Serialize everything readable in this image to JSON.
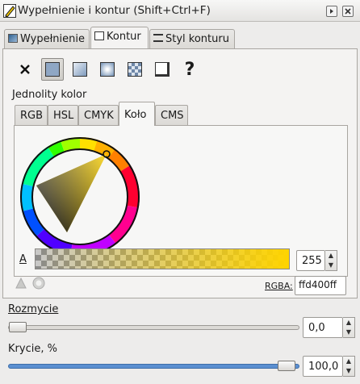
{
  "window": {
    "title": "Wypełnienie i kontur (Shift+Ctrl+F)"
  },
  "tabs": [
    {
      "label": "Wypełnienie"
    },
    {
      "label": "Kontur"
    },
    {
      "label": "Styl konturu"
    }
  ],
  "fill_modes": [
    "none",
    "flat-color",
    "linear-gradient",
    "radial-gradient",
    "pattern",
    "swatch",
    "unset"
  ],
  "fill_modes_selected": "flat-color",
  "section_label": "Jednolity kolor",
  "color_tabs": [
    {
      "label": "RGB"
    },
    {
      "label": "HSL"
    },
    {
      "label": "CMYK"
    },
    {
      "label": "Koło"
    },
    {
      "label": "CMS"
    }
  ],
  "color": {
    "alpha_label": "A",
    "alpha_value": "255",
    "rgba_label": "RGBA:",
    "rgba_value": "ffd400ff",
    "hex": "#ffd400"
  },
  "blur": {
    "label": "Rozmycie",
    "value": "0,0",
    "level": 0.0
  },
  "opacity": {
    "label": "Krycie, %",
    "value": "100,0",
    "level": 1.0
  }
}
